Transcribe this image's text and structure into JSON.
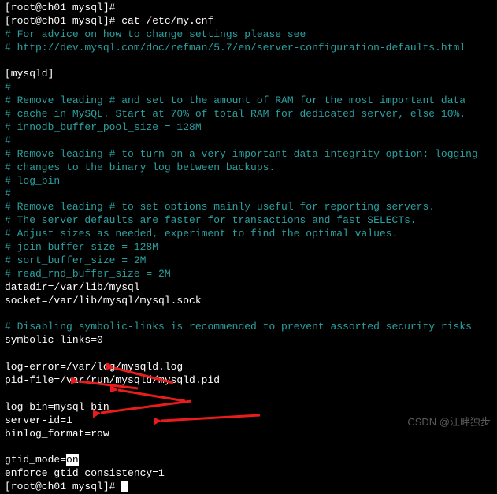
{
  "prompt_line_top_partial": "[root@ch01 mysql]#",
  "cmd_line": {
    "prompt": "[root@ch01 mysql]# ",
    "command": "cat /etc/my.cnf"
  },
  "comments": {
    "c1": "# For advice on how to change settings please see",
    "c2": "# http://dev.mysql.com/doc/refman/5.7/en/server-configuration-defaults.html",
    "c3": "#",
    "c4": "# Remove leading # and set to the amount of RAM for the most important data",
    "c5": "# cache in MySQL. Start at 70% of total RAM for dedicated server, else 10%.",
    "c6": "# innodb_buffer_pool_size = 128M",
    "c7": "#",
    "c8": "# Remove leading # to turn on a very important data integrity option: logging",
    "c9": "# changes to the binary log between backups.",
    "c10": "# log_bin",
    "c11": "#",
    "c12": "# Remove leading # to set options mainly useful for reporting servers.",
    "c13": "# The server defaults are faster for transactions and fast SELECTs.",
    "c14": "# Adjust sizes as needed, experiment to find the optimal values.",
    "c15": "# join_buffer_size = 128M",
    "c16": "# sort_buffer_size = 2M",
    "c17": "# read_rnd_buffer_size = 2M",
    "c18": "# Disabling symbolic-links is recommended to prevent assorted security risks"
  },
  "section": "[mysqld]",
  "settings": {
    "datadir": "datadir=/var/lib/mysql",
    "socket": "socket=/var/lib/mysql/mysql.sock",
    "symlinks": "symbolic-links=0",
    "logerror": "log-error=/var/log/mysqld.log",
    "pidfile": "pid-file=/var/run/mysqld/mysqld.pid",
    "logbin": "log-bin=mysql-bin",
    "serverid": "server-id=1",
    "binlogformat": "binlog_format=row",
    "gtidmode_pre": "gtid_mode=",
    "gtidmode_hl": "on",
    "enforce": "enforce_gtid_consistency=1"
  },
  "prompt_end": "[root@ch01 mysql]# ",
  "watermark": "CSDN @江畔独步"
}
